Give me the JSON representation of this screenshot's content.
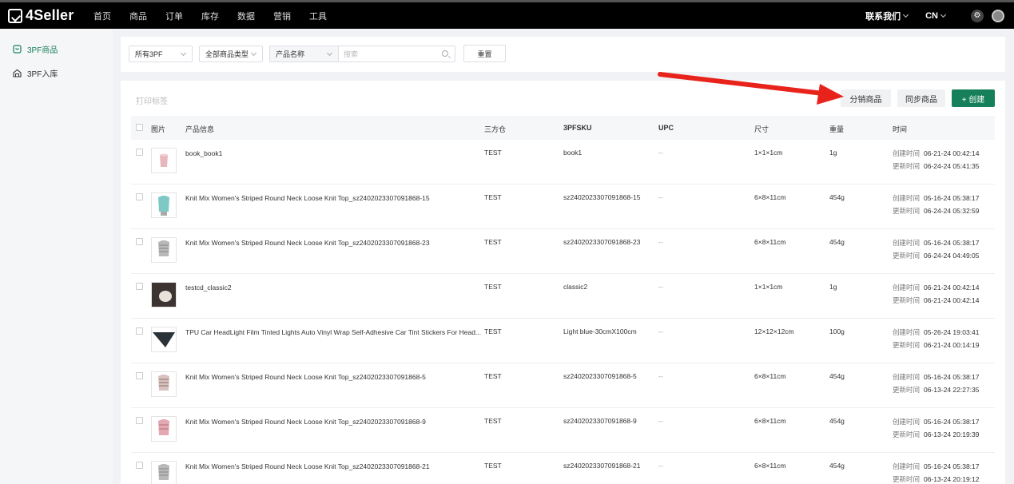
{
  "brand": {
    "name": "4Seller"
  },
  "nav": [
    "首页",
    "商品",
    "订单",
    "库存",
    "数据",
    "营销",
    "工具"
  ],
  "topRight": {
    "contact": "联系我们",
    "lang": "CN"
  },
  "sidebar": {
    "items": [
      {
        "label": "3PF商品",
        "active": true
      },
      {
        "label": "3PF入库",
        "active": false
      }
    ]
  },
  "filters": {
    "warehouse": "所有3PF",
    "productType": "全部商品类型",
    "field": "产品名称",
    "searchPlaceholder": "搜索",
    "reset": "重置"
  },
  "toolbar": {
    "printLabel": "打印标签",
    "distribute": "分销商品",
    "sync": "同步商品",
    "create": "+ 创建"
  },
  "table": {
    "headers": [
      "图片",
      "产品信息",
      "三方仓",
      "3PFSKU",
      "UPC",
      "尺寸",
      "重量",
      "时间"
    ],
    "createdLabel": "创建时间",
    "updatedLabel": "更新时间",
    "rows": [
      {
        "name": "book_book1",
        "warehouse": "TEST",
        "sku": "book1",
        "upc": "--",
        "size": "1×1×1cm",
        "weight": "1g",
        "created": "06-21-24 00:42:14",
        "updated": "06-24-24 05:41:35",
        "thumb": "mug"
      },
      {
        "name": "Knit Mix Women's Striped Round Neck Loose Knit Top_sz2402023307091868-15",
        "warehouse": "TEST",
        "sku": "sz2402023307091868-15",
        "upc": "--",
        "size": "6×8×11cm",
        "weight": "454g",
        "created": "05-16-24 05:38:17",
        "updated": "06-24-24 05:32:59",
        "thumb": "teal"
      },
      {
        "name": "Knit Mix Women's Striped Round Neck Loose Knit Top_sz2402023307091868-23",
        "warehouse": "TEST",
        "sku": "sz2402023307091868-23",
        "upc": "--",
        "size": "6×8×11cm",
        "weight": "454g",
        "created": "05-16-24 05:38:17",
        "updated": "06-24-24 04:49:05",
        "thumb": "grey"
      },
      {
        "name": "testcd_classic2",
        "warehouse": "TEST",
        "sku": "classic2",
        "upc": "--",
        "size": "1×1×1cm",
        "weight": "1g",
        "created": "06-21-24 00:42:14",
        "updated": "06-21-24 00:42:14",
        "thumb": "photo"
      },
      {
        "name": "TPU Car HeadLight Film Tinted Lights Auto Vinyl Wrap Self-Adhesive Car Tint Stickers For Head...",
        "warehouse": "TEST",
        "sku": "Light blue-30cmX100cm",
        "upc": "--",
        "size": "12×12×12cm",
        "weight": "100g",
        "created": "05-26-24 19:03:41",
        "updated": "06-21-24 00:14:19",
        "thumb": "film"
      },
      {
        "name": "Knit Mix Women's Striped Round Neck Loose Knit Top_sz2402023307091868-5",
        "warehouse": "TEST",
        "sku": "sz2402023307091868-5",
        "upc": "--",
        "size": "6×8×11cm",
        "weight": "454g",
        "created": "05-16-24 05:38:17",
        "updated": "06-13-24 22:27:35",
        "thumb": "stripe"
      },
      {
        "name": "Knit Mix Women's Striped Round Neck Loose Knit Top_sz2402023307091868-9",
        "warehouse": "TEST",
        "sku": "sz2402023307091868-9",
        "upc": "--",
        "size": "6×8×11cm",
        "weight": "454g",
        "created": "05-16-24 05:38:17",
        "updated": "06-13-24 20:19:39",
        "thumb": "pink"
      },
      {
        "name": "Knit Mix Women's Striped Round Neck Loose Knit Top_sz2402023307091868-21",
        "warehouse": "TEST",
        "sku": "sz2402023307091868-21",
        "upc": "--",
        "size": "6×8×11cm",
        "weight": "454g",
        "created": "05-16-24 05:38:17",
        "updated": "06-13-24 20:19:12",
        "thumb": "grey"
      }
    ]
  },
  "colors": {
    "accent": "#16805a",
    "annotation": "#e8231c",
    "topbar": "#000000"
  }
}
